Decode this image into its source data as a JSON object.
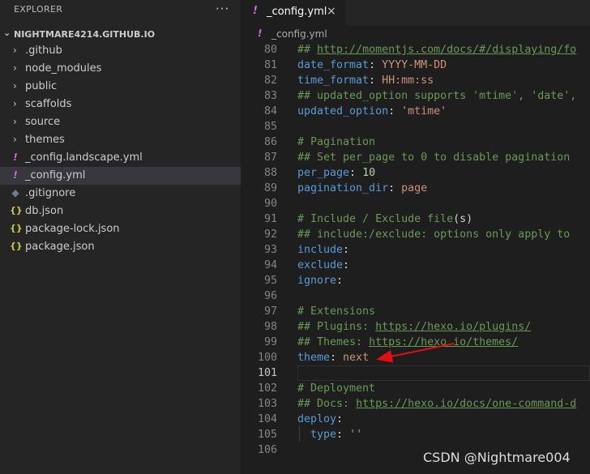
{
  "sidebar": {
    "title": "EXPLORER",
    "more": "···",
    "project": "NIGHTMARE4214.GITHUB.IO",
    "items": [
      {
        "label": ".github",
        "type": "folder"
      },
      {
        "label": "node_modules",
        "type": "folder"
      },
      {
        "label": "public",
        "type": "folder"
      },
      {
        "label": "scaffolds",
        "type": "folder"
      },
      {
        "label": "source",
        "type": "folder"
      },
      {
        "label": "themes",
        "type": "folder"
      },
      {
        "label": "_config.landscape.yml",
        "type": "yml",
        "icon": "!"
      },
      {
        "label": "_config.yml",
        "type": "yml",
        "icon": "!"
      },
      {
        "label": ".gitignore",
        "type": "git",
        "icon": "◆"
      },
      {
        "label": "db.json",
        "type": "json",
        "icon": "{}"
      },
      {
        "label": "package-lock.json",
        "type": "json",
        "icon": "{}"
      },
      {
        "label": "package.json",
        "type": "json",
        "icon": "{}"
      }
    ]
  },
  "tab": {
    "icon": "!",
    "label": "_config.yml",
    "close": "×"
  },
  "breadcrumb": {
    "icon": "!",
    "label": "_config.yml"
  },
  "code": {
    "lines": [
      {
        "n": "80",
        "t": [
          [
            "c",
            "## "
          ],
          [
            "l",
            "http://momentjs.com/docs/#/displaying/fo"
          ]
        ]
      },
      {
        "n": "81",
        "t": [
          [
            "k",
            "date_format"
          ],
          [
            "p",
            ": "
          ],
          [
            "v",
            "YYYY-MM-DD"
          ]
        ]
      },
      {
        "n": "82",
        "t": [
          [
            "k",
            "time_format"
          ],
          [
            "p",
            ": "
          ],
          [
            "v",
            "HH:mm:ss"
          ]
        ]
      },
      {
        "n": "83",
        "t": [
          [
            "c",
            "## updated_option supports 'mtime', 'date',"
          ]
        ]
      },
      {
        "n": "84",
        "t": [
          [
            "k",
            "updated_option"
          ],
          [
            "p",
            ": "
          ],
          [
            "v",
            "'mtime'"
          ]
        ]
      },
      {
        "n": "85",
        "t": []
      },
      {
        "n": "86",
        "t": [
          [
            "c",
            "# Pagination"
          ]
        ]
      },
      {
        "n": "87",
        "t": [
          [
            "c",
            "## Set per_page to 0 to disable pagination"
          ]
        ]
      },
      {
        "n": "88",
        "t": [
          [
            "k",
            "per_page"
          ],
          [
            "p",
            ": "
          ],
          [
            "num",
            "10"
          ]
        ]
      },
      {
        "n": "89",
        "t": [
          [
            "k",
            "pagination_dir"
          ],
          [
            "p",
            ": "
          ],
          [
            "v",
            "page"
          ]
        ]
      },
      {
        "n": "90",
        "t": []
      },
      {
        "n": "91",
        "t": [
          [
            "c",
            "# Include / Exclude file"
          ],
          [
            "p",
            "(s)"
          ]
        ]
      },
      {
        "n": "92",
        "t": [
          [
            "c",
            "## include:/exclude: options only apply to"
          ]
        ]
      },
      {
        "n": "93",
        "t": [
          [
            "k",
            "include"
          ],
          [
            "p",
            ":"
          ]
        ]
      },
      {
        "n": "94",
        "t": [
          [
            "k",
            "exclude"
          ],
          [
            "p",
            ":"
          ]
        ]
      },
      {
        "n": "95",
        "t": [
          [
            "k",
            "ignore"
          ],
          [
            "p",
            ":"
          ]
        ]
      },
      {
        "n": "96",
        "t": []
      },
      {
        "n": "97",
        "t": [
          [
            "c",
            "# Extensions"
          ]
        ]
      },
      {
        "n": "98",
        "t": [
          [
            "c",
            "## Plugins: "
          ],
          [
            "l",
            "https://hexo.io/plugins/"
          ]
        ]
      },
      {
        "n": "99",
        "t": [
          [
            "c",
            "## Themes: "
          ],
          [
            "l",
            "https://hexo.io/themes/"
          ]
        ]
      },
      {
        "n": "100",
        "t": [
          [
            "k",
            "theme"
          ],
          [
            "p",
            ": "
          ],
          [
            "v",
            "next"
          ]
        ]
      },
      {
        "n": "101",
        "t": [],
        "current": true
      },
      {
        "n": "102",
        "t": [
          [
            "c",
            "# Deployment"
          ]
        ]
      },
      {
        "n": "103",
        "t": [
          [
            "c",
            "## Docs: "
          ],
          [
            "l",
            "https://hexo.io/docs/one-command-d"
          ]
        ]
      },
      {
        "n": "104",
        "t": [
          [
            "k",
            "deploy"
          ],
          [
            "p",
            ":"
          ]
        ]
      },
      {
        "n": "105",
        "t": [
          [
            "p",
            "  "
          ],
          [
            "k",
            "type"
          ],
          [
            "p",
            ": "
          ],
          [
            "v",
            "''"
          ]
        ]
      },
      {
        "n": "106",
        "t": []
      }
    ]
  },
  "watermark": "CSDN @Nightmare004",
  "colors": {
    "arrow": "#e01010",
    "yml_icon": "#cc6ad8",
    "json_icon": "#cbcb41",
    "git_icon": "#6d8086"
  }
}
